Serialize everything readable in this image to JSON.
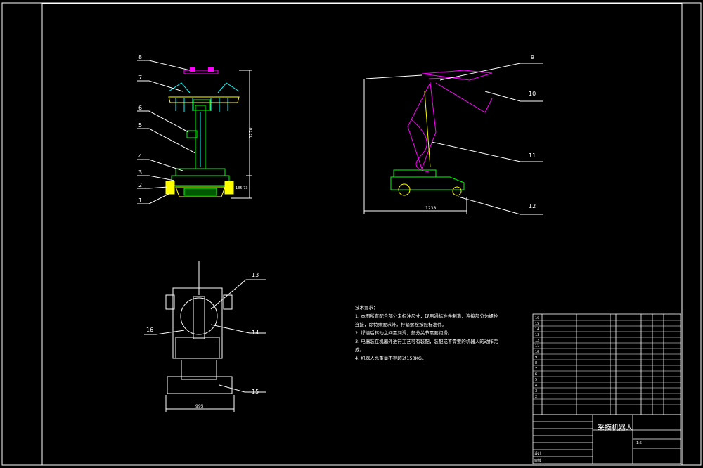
{
  "callouts": [
    "1",
    "2",
    "3",
    "4",
    "5",
    "6",
    "7",
    "8",
    "9",
    "10",
    "11",
    "12",
    "13",
    "14",
    "15",
    "16"
  ],
  "dimensions": {
    "front_height": "1270",
    "front_base": "185.73",
    "side_width": "1238",
    "bottom_width": "995"
  },
  "technical_requirements": {
    "title": "技术要求：",
    "items": [
      "1. 本图所有配合部分未标注尺寸，现用通标准件制造，连接部分为螺栓",
      "连接，除特殊要求外，拧紧螺栓按照标准件。",
      "2. 焊接后转动之间需润滑，部分关节需要润滑。",
      "3. 电器装在机器外进行工艺可有装配，装配或不需要的机器人的动作完",
      "成。",
      "4. 机器人总重量不得超过150KG。"
    ]
  },
  "title_block": {
    "drawing_name": "采摘机器人",
    "small_labels": [
      "标记",
      "处数",
      "分区",
      "更改文件号",
      "签名",
      "年月日",
      "设计",
      "审核",
      "工艺",
      "批准",
      "阶段标记",
      "重量",
      "比例",
      "共 张",
      "第 张"
    ],
    "scale": "1:5"
  },
  "parts_table": {
    "rows": [
      "16",
      "15",
      "14",
      "13",
      "12",
      "11",
      "10",
      "9",
      "8",
      "7",
      "6",
      "5",
      "4",
      "3",
      "2",
      "1"
    ]
  }
}
